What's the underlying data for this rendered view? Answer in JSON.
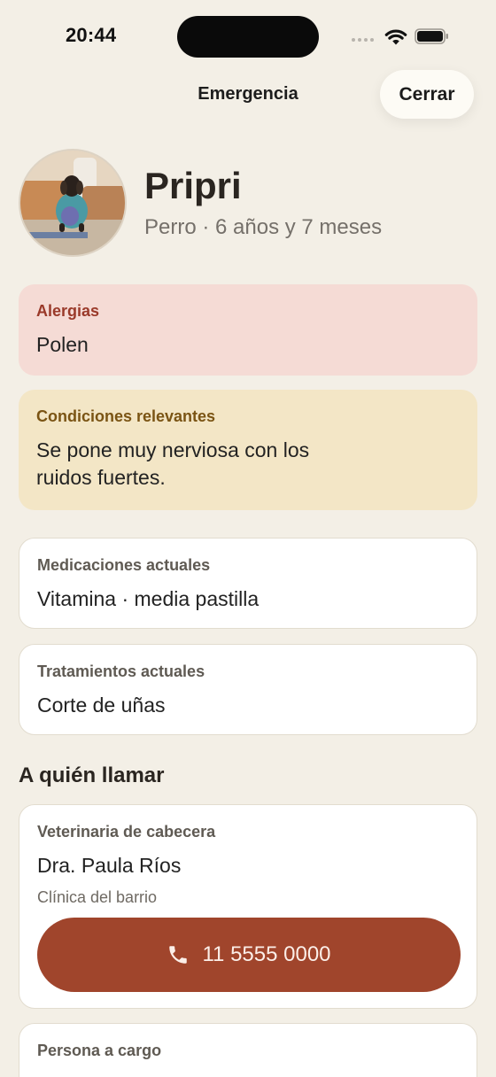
{
  "status_bar": {
    "time": "20:44"
  },
  "header": {
    "title": "Emergencia",
    "close_label": "Cerrar"
  },
  "pet": {
    "name": "Pripri",
    "subtitle": "Perro · 6 años y 7 meses"
  },
  "allergies": {
    "label": "Alergias",
    "value": "Polen"
  },
  "conditions": {
    "label": "Condiciones relevantes",
    "value_line1": "Se pone muy nerviosa con los",
    "value_line2": "ruidos fuertes."
  },
  "medications": {
    "label": "Medicaciones actuales",
    "value": "Vitamina · media pastilla"
  },
  "treatments": {
    "label": "Tratamientos actuales",
    "value": "Corte de uñas"
  },
  "contacts": {
    "section_title": "A quién llamar",
    "vet": {
      "label": "Veterinaria de cabecera",
      "name": "Dra. Paula Ríos",
      "clinic": "Clínica del barrio",
      "phone": "11 5555 0000"
    },
    "guardian": {
      "label": "Persona a cargo"
    }
  },
  "colors": {
    "background": "#f3efe6",
    "allergy_card": "#f5dbd5",
    "condition_card": "#f3e6c6",
    "call_button": "#a0452c"
  }
}
